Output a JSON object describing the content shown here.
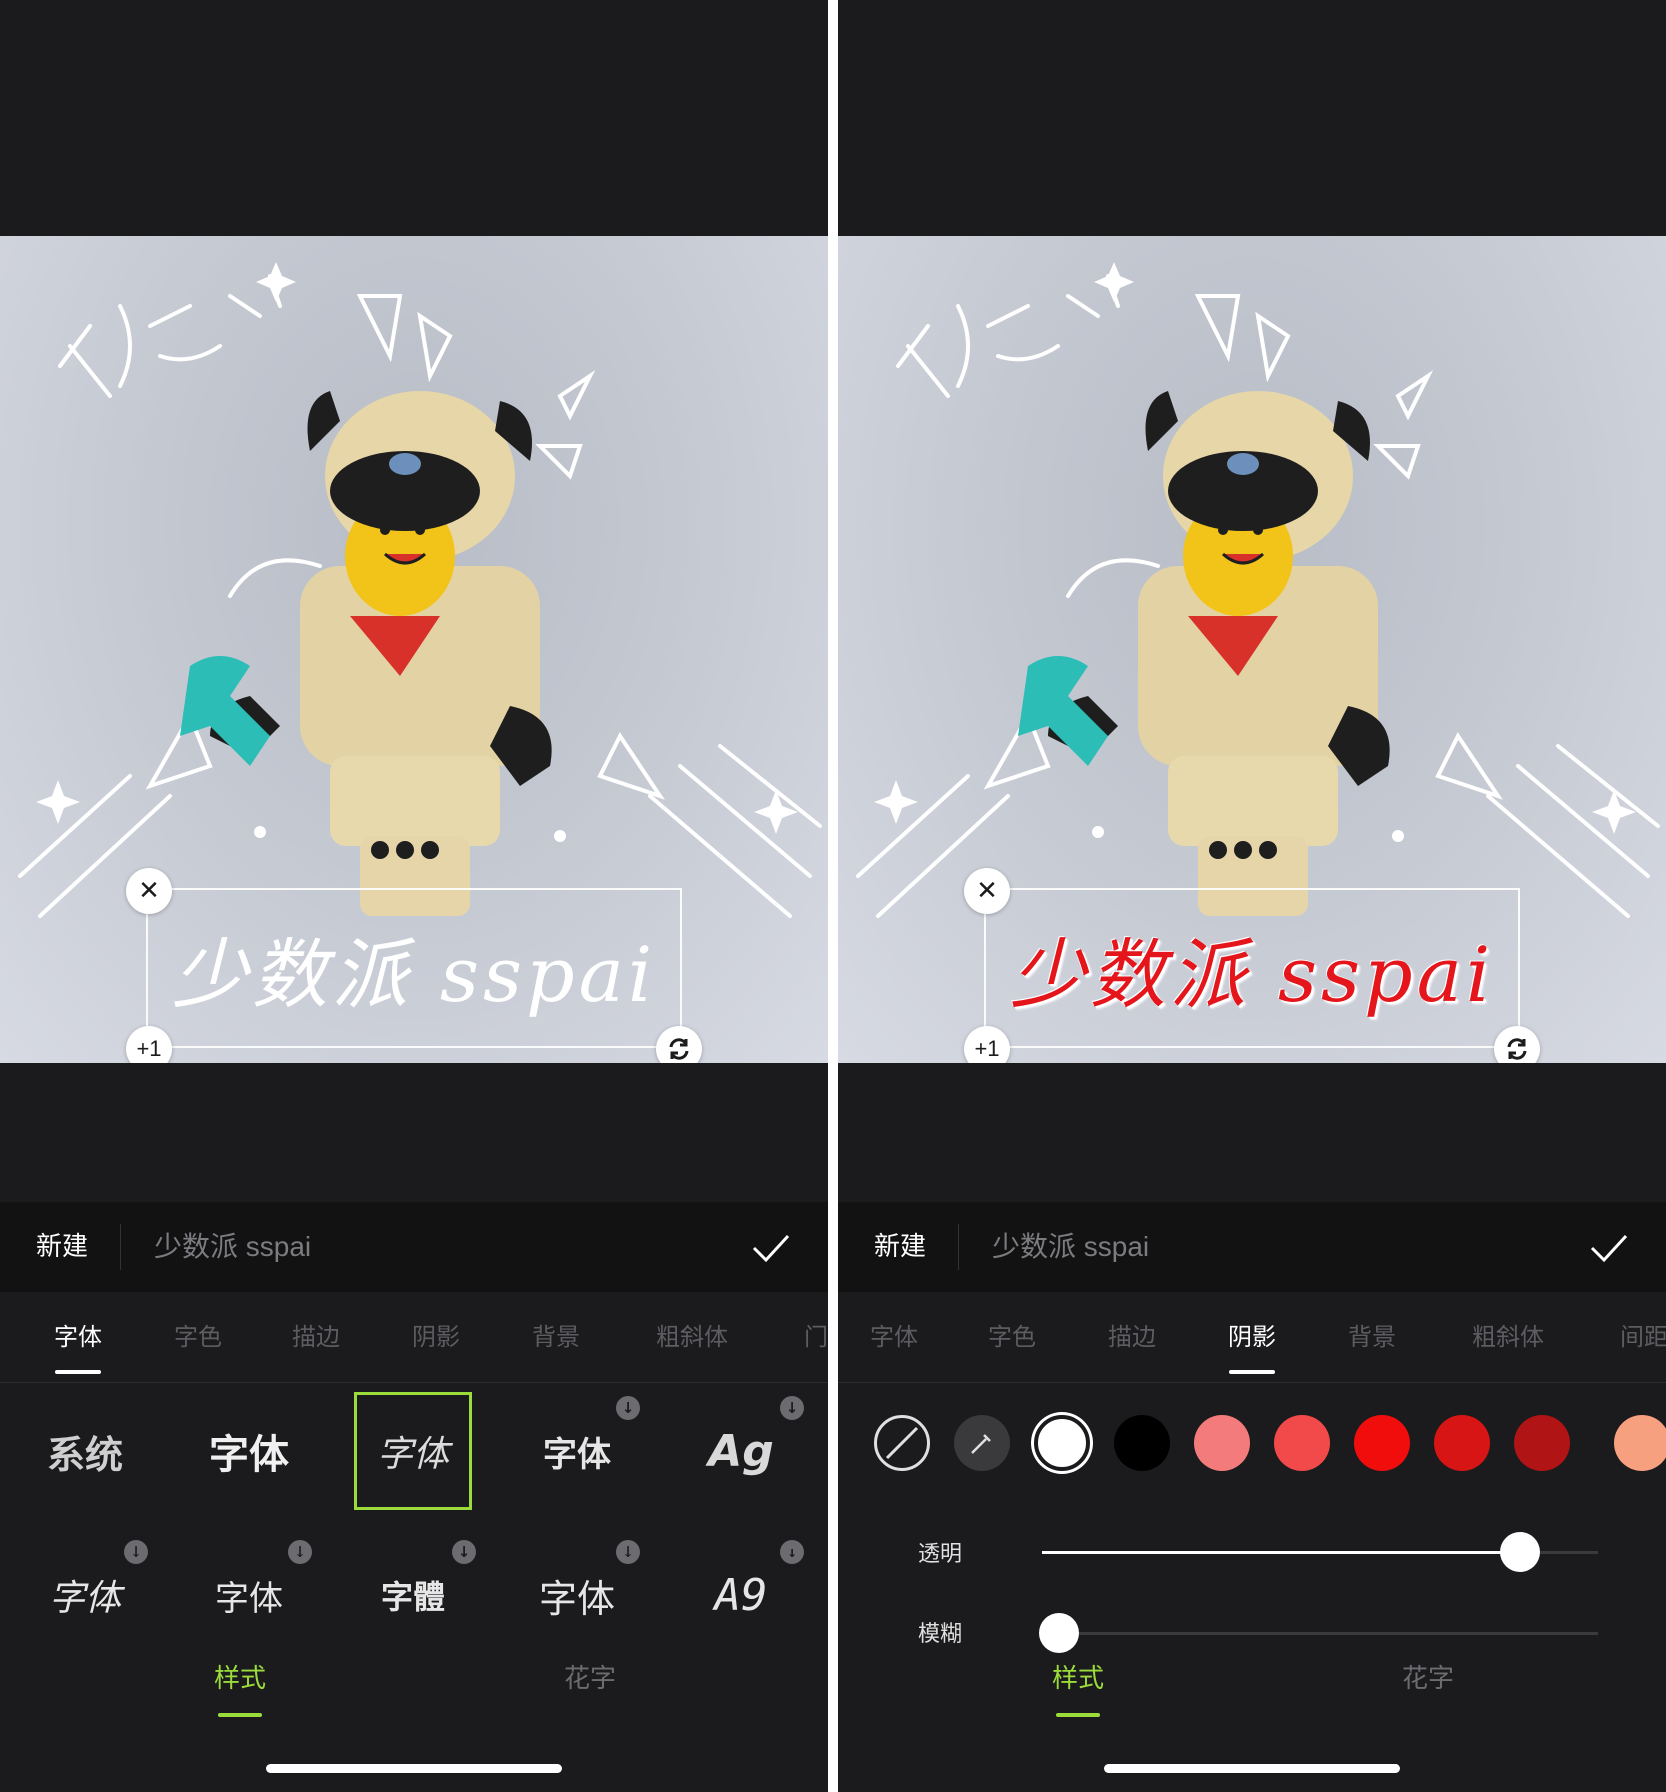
{
  "left": {
    "canvas": {
      "overlay_text": "少数派 sspai",
      "plus_label": "+1"
    },
    "toolbar": {
      "new_label": "新建",
      "text_value": "少数派 sspai"
    },
    "tabs": [
      {
        "label": "字体",
        "active": true
      },
      {
        "label": "字色",
        "active": false
      },
      {
        "label": "描边",
        "active": false
      },
      {
        "label": "阴影",
        "active": false
      },
      {
        "label": "背景",
        "active": false
      },
      {
        "label": "粗斜体",
        "active": false
      },
      {
        "label": "门",
        "active": false
      }
    ],
    "fonts_row1": [
      {
        "label": "系统",
        "download": false
      },
      {
        "label": "字体",
        "download": false
      },
      {
        "label": "字体",
        "download": false,
        "selected": true
      },
      {
        "label": "字体",
        "download": true
      },
      {
        "label": "Ag",
        "download": true
      }
    ],
    "fonts_row2": [
      {
        "label": "字体",
        "download": true
      },
      {
        "label": "字体",
        "download": true
      },
      {
        "label": "字體",
        "download": true
      },
      {
        "label": "字体",
        "download": true
      },
      {
        "label": "A9",
        "download": true
      }
    ],
    "bottom_tabs": [
      {
        "label": "样式",
        "active": true
      },
      {
        "label": "花字",
        "active": false
      }
    ]
  },
  "right": {
    "canvas": {
      "overlay_text": "少数派 sspai",
      "plus_label": "+1"
    },
    "toolbar": {
      "new_label": "新建",
      "text_value": "少数派 sspai"
    },
    "tabs": [
      {
        "label": "字体",
        "active": false
      },
      {
        "label": "字色",
        "active": false
      },
      {
        "label": "描边",
        "active": false
      },
      {
        "label": "阴影",
        "active": true
      },
      {
        "label": "背景",
        "active": false
      },
      {
        "label": "粗斜体",
        "active": false
      },
      {
        "label": "间距",
        "active": false
      }
    ],
    "swatches": [
      {
        "type": "none",
        "color": "#1b1b1d"
      },
      {
        "type": "eyedropper",
        "color": "#3a3a3c"
      },
      {
        "type": "color",
        "color": "#ffffff",
        "selected": true
      },
      {
        "type": "color",
        "color": "#000000"
      },
      {
        "type": "color",
        "color": "#f47b7b"
      },
      {
        "type": "color",
        "color": "#f24a4a"
      },
      {
        "type": "color",
        "color": "#f20d0d"
      },
      {
        "type": "color",
        "color": "#d81515"
      },
      {
        "type": "color",
        "color": "#b01414"
      },
      {
        "type": "color",
        "color": "#f6a07f"
      }
    ],
    "sliders": [
      {
        "label": "透明",
        "value": 0.86
      },
      {
        "label": "模糊",
        "value": 0.0
      }
    ],
    "bottom_tabs": [
      {
        "label": "样式",
        "active": true
      },
      {
        "label": "花字",
        "active": false
      }
    ]
  },
  "colors": {
    "accent": "#9bdc3a",
    "background": "#1b1b1d",
    "toolbar": "#121213"
  }
}
